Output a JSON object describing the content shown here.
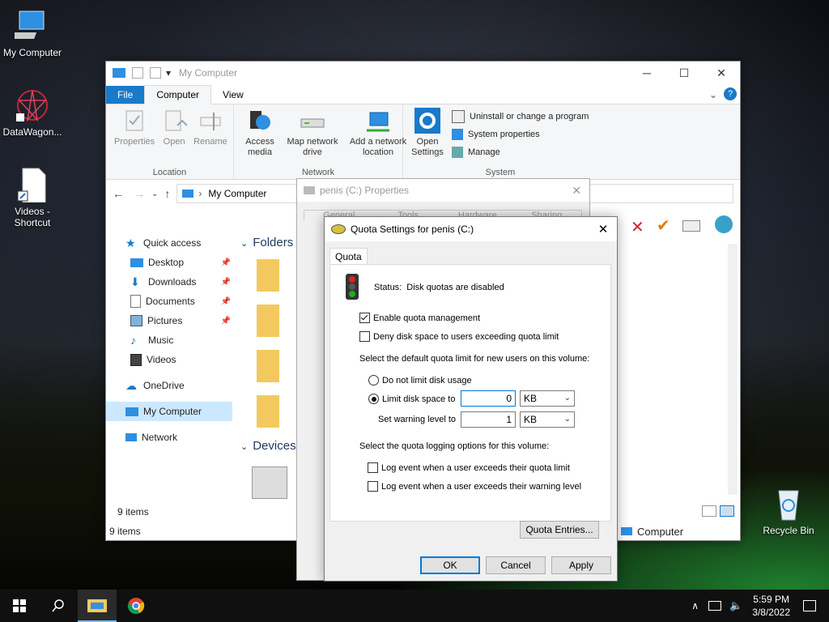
{
  "desktop": {
    "icons": [
      {
        "label": "My Computer"
      },
      {
        "label": "DataWagon..."
      },
      {
        "label": "Videos - Shortcut"
      },
      {
        "label": "Recycle Bin"
      }
    ]
  },
  "explorer": {
    "title": "My Computer",
    "ribbon_tabs": [
      "File",
      "Computer",
      "View"
    ],
    "location_group": {
      "label": "Location",
      "buttons": [
        "Properties",
        "Open",
        "Rename"
      ]
    },
    "network_group": {
      "label": "Network",
      "buttons": [
        "Access media",
        "Map network drive",
        "Add a network location"
      ]
    },
    "system_group": {
      "label": "System",
      "open_settings": "Open Settings",
      "items": [
        "Uninstall or change a program",
        "System properties",
        "Manage"
      ]
    },
    "address": "My Computer",
    "sections": {
      "folders": "Folders",
      "devices": "Devices"
    },
    "nav": [
      {
        "label": "Quick access",
        "icon": "star-icon"
      },
      {
        "label": "Desktop",
        "icon": "desktop-icon",
        "pinned": true
      },
      {
        "label": "Downloads",
        "icon": "download-icon",
        "pinned": true
      },
      {
        "label": "Documents",
        "icon": "document-icon",
        "pinned": true
      },
      {
        "label": "Pictures",
        "icon": "picture-icon",
        "pinned": true
      },
      {
        "label": "Music",
        "icon": "music-icon"
      },
      {
        "label": "Videos",
        "icon": "video-icon"
      },
      {
        "label": "OneDrive",
        "icon": "cloud-icon"
      },
      {
        "label": "My Computer",
        "icon": "computer-icon",
        "selected": true
      },
      {
        "label": "Network",
        "icon": "network-icon"
      }
    ],
    "item_count": "9 items",
    "status_count": "9 items",
    "status_location": "Computer"
  },
  "properties_dialog": {
    "title": "penis (C:) Properties",
    "tabs": [
      "General",
      "Tools",
      "Hardware",
      "Sharing"
    ]
  },
  "quota_dialog": {
    "title": "Quota Settings for penis (C:)",
    "tab": "Quota",
    "status_label": "Status:",
    "status_value": "Disk quotas are disabled",
    "enable_quota": "Enable quota management",
    "deny_space": "Deny disk space to users exceeding quota limit",
    "default_limit_heading": "Select the default quota limit for new users on this volume:",
    "no_limit": "Do not limit disk usage",
    "limit_to": "Limit disk space to",
    "limit_value": "0",
    "limit_unit": "KB",
    "warning_label": "Set warning level to",
    "warning_value": "1",
    "warning_unit": "KB",
    "logging_heading": "Select the quota logging options for this volume:",
    "log_limit": "Log event when a user exceeds their quota limit",
    "log_warning": "Log event when a user exceeds their warning level",
    "entries_button": "Quota Entries...",
    "ok": "OK",
    "cancel": "Cancel",
    "apply": "Apply"
  },
  "taskbar": {
    "time": "5:59 PM",
    "date": "3/8/2022"
  }
}
